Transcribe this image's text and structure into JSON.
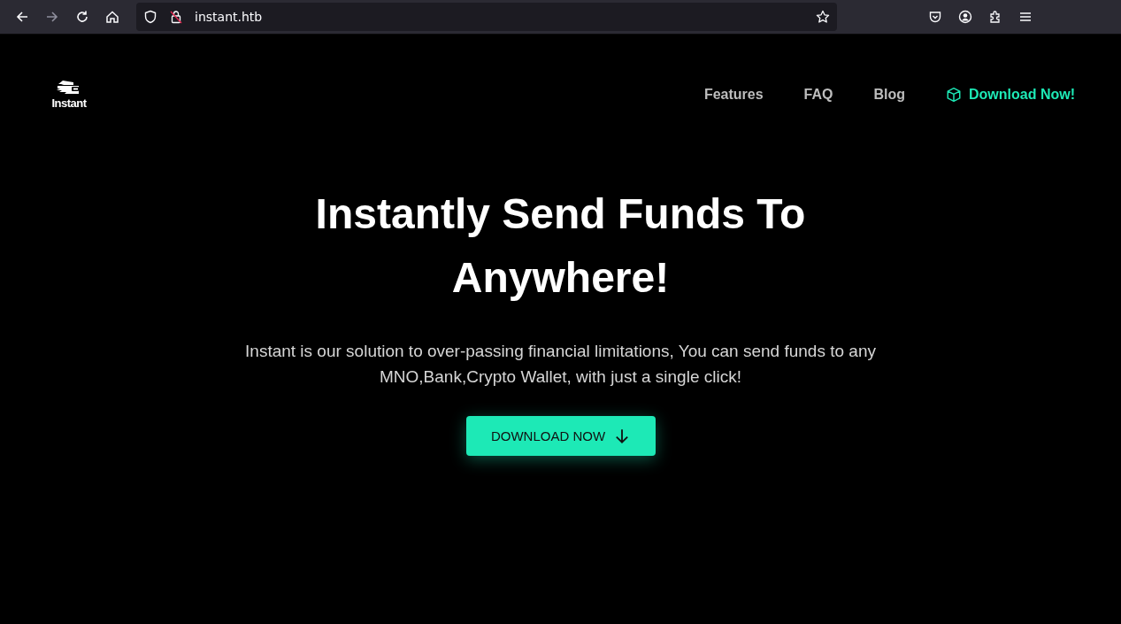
{
  "browser": {
    "url": "instant.htb",
    "forward_disabled": true
  },
  "site": {
    "logo_text": "Instant",
    "nav": [
      {
        "label": "Features",
        "kind": "link"
      },
      {
        "label": "FAQ",
        "kind": "link"
      },
      {
        "label": "Blog",
        "kind": "link"
      },
      {
        "label": "Download Now!",
        "kind": "cta"
      }
    ],
    "hero": {
      "title_lines": [
        "Instantly Send Funds To",
        "Anywhere!"
      ],
      "text": "Instant is our solution to over-passing financial limitations, You can send funds to any MNO,Bank,Crypto Wallet, with just a single click!",
      "button": "DOWNLOAD NOW"
    }
  }
}
